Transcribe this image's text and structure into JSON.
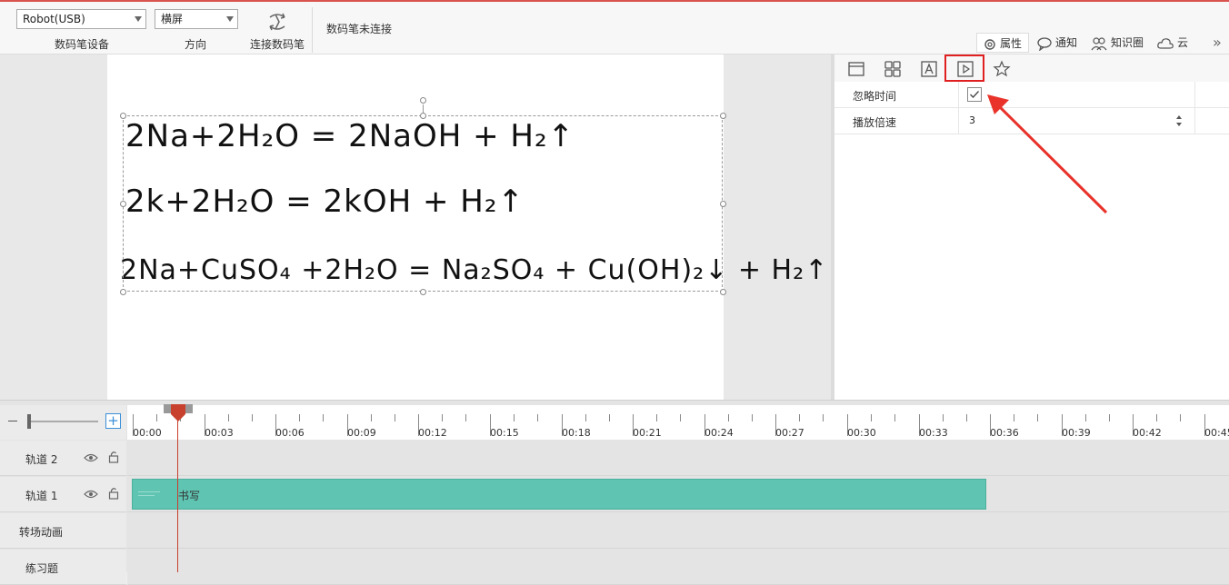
{
  "toolbar": {
    "device_select": "Robot(USB)",
    "device_label": "数码笔设备",
    "orientation_select": "横屏",
    "orientation_label": "方向",
    "connect_label": "连接数码笔",
    "status": "数码笔未连接",
    "right_tabs": [
      {
        "label": "属性",
        "icon": "gear-icon"
      },
      {
        "label": "通知",
        "icon": "chat-bubble-icon"
      },
      {
        "label": "知识圈",
        "icon": "people-icon"
      },
      {
        "label": "云",
        "icon": "cloud-icon"
      }
    ],
    "more_icon": "double-chevron-right-icon"
  },
  "canvas": {
    "equations": [
      "2Na+2H₂O = 2NaOH + H₂↑",
      "2k+2H₂O = 2kOH + H₂↑",
      "2Na+CuSO₄ +2H₂O = Na₂SO₄ + Cu(OH)₂↓ + H₂↑"
    ]
  },
  "properties": {
    "tabs": [
      "layout-icon",
      "grid-icon",
      "text-icon",
      "play-icon",
      "star-icon"
    ],
    "active_tab": "play-icon",
    "rows": [
      {
        "label": "忽略时间",
        "type": "checkbox",
        "checked": true
      },
      {
        "label": "播放倍速",
        "type": "spinner",
        "value": "3"
      }
    ]
  },
  "timeline": {
    "ruler_labels": [
      "00:00",
      "00:03",
      "00:06",
      "00:09",
      "00:12",
      "00:15",
      "00:18",
      "00:21",
      "00:24",
      "00:27",
      "00:30",
      "00:33",
      "00:36",
      "00:39",
      "00:42",
      "00:45"
    ],
    "tracks": [
      {
        "name": "轨道 2",
        "clip": ""
      },
      {
        "name": "轨道 1",
        "clip": "书写"
      },
      {
        "name": "转场动画",
        "clip": ""
      },
      {
        "name": "练习题",
        "clip": ""
      }
    ],
    "clip_color": "#5fc4b2",
    "playhead_color": "#c8412e"
  },
  "colors": {
    "accent": "#e02020"
  }
}
